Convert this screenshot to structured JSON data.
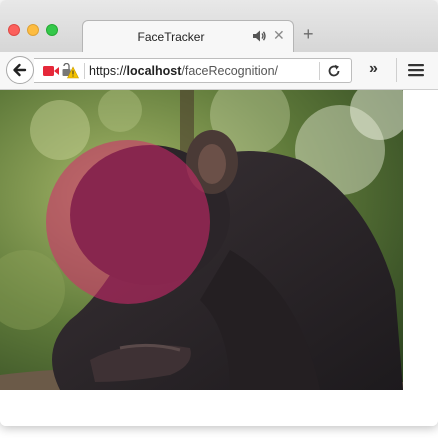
{
  "window": {
    "tab": {
      "title": "FaceTracker",
      "audio_icon": "speaker-icon",
      "close_label": "✕"
    },
    "new_tab_label": "+"
  },
  "navbar": {
    "url": {
      "scheme": "https://",
      "host": "localhost",
      "path": "/faceRecognition/"
    },
    "overflow_label": "»",
    "icons": [
      "back-arrow-icon",
      "camera-icon",
      "permission-warning-icon",
      "reload-icon",
      "hamburger-menu-icon"
    ]
  },
  "content": {
    "image": "chimpanzee photo",
    "face_marker_color": "#d6286e"
  },
  "colors": {
    "close": "#fc605c",
    "minimize": "#fdbc40",
    "maximize": "#34c84a",
    "camera": "#e5283a",
    "warning": "#f5c200"
  }
}
